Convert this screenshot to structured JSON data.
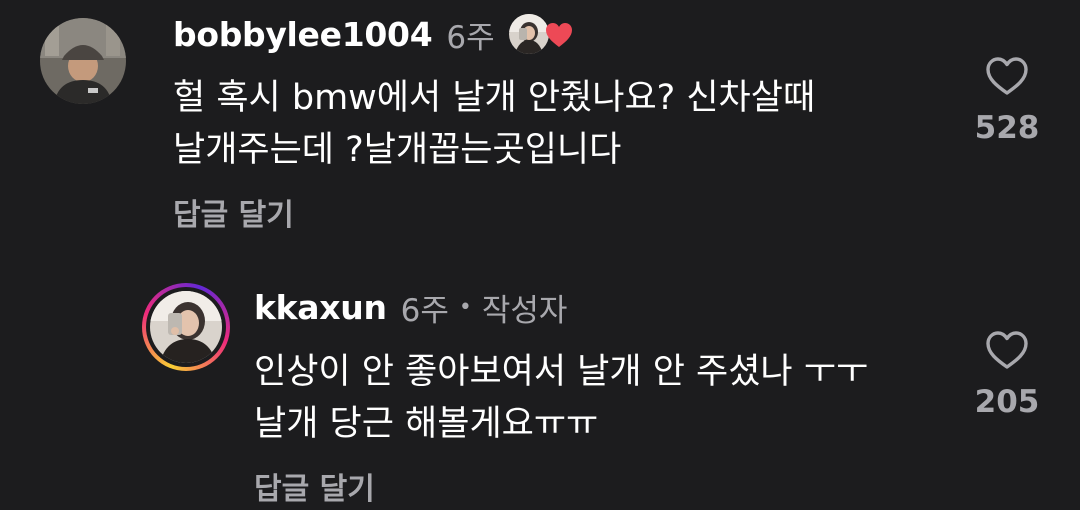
{
  "comments": [
    {
      "username": "bobbylee1004",
      "time": "6주",
      "author_liked_icon": "heart-icon",
      "lines": [
        "헐 혹시 bmw에서 날개 안줬나요? 신차살때",
        "날개주는데 ?날개꼽는곳입니다"
      ],
      "reply_label": "답글 달기",
      "like_count": "528"
    },
    {
      "username": "kkaxun",
      "time": "6주",
      "separator": "•",
      "author_tag": "작성자",
      "lines": [
        "인상이 안 좋아보여서 날개 안 주셨나 ㅜㅜ",
        "날개 당근 해볼게요ㅠㅠ"
      ],
      "reply_label": "답글 달기",
      "like_count": "205"
    }
  ],
  "colors": {
    "background": "#1c1c1e",
    "secondary_text": "#a8a8ad",
    "heart": "#ed4956"
  }
}
